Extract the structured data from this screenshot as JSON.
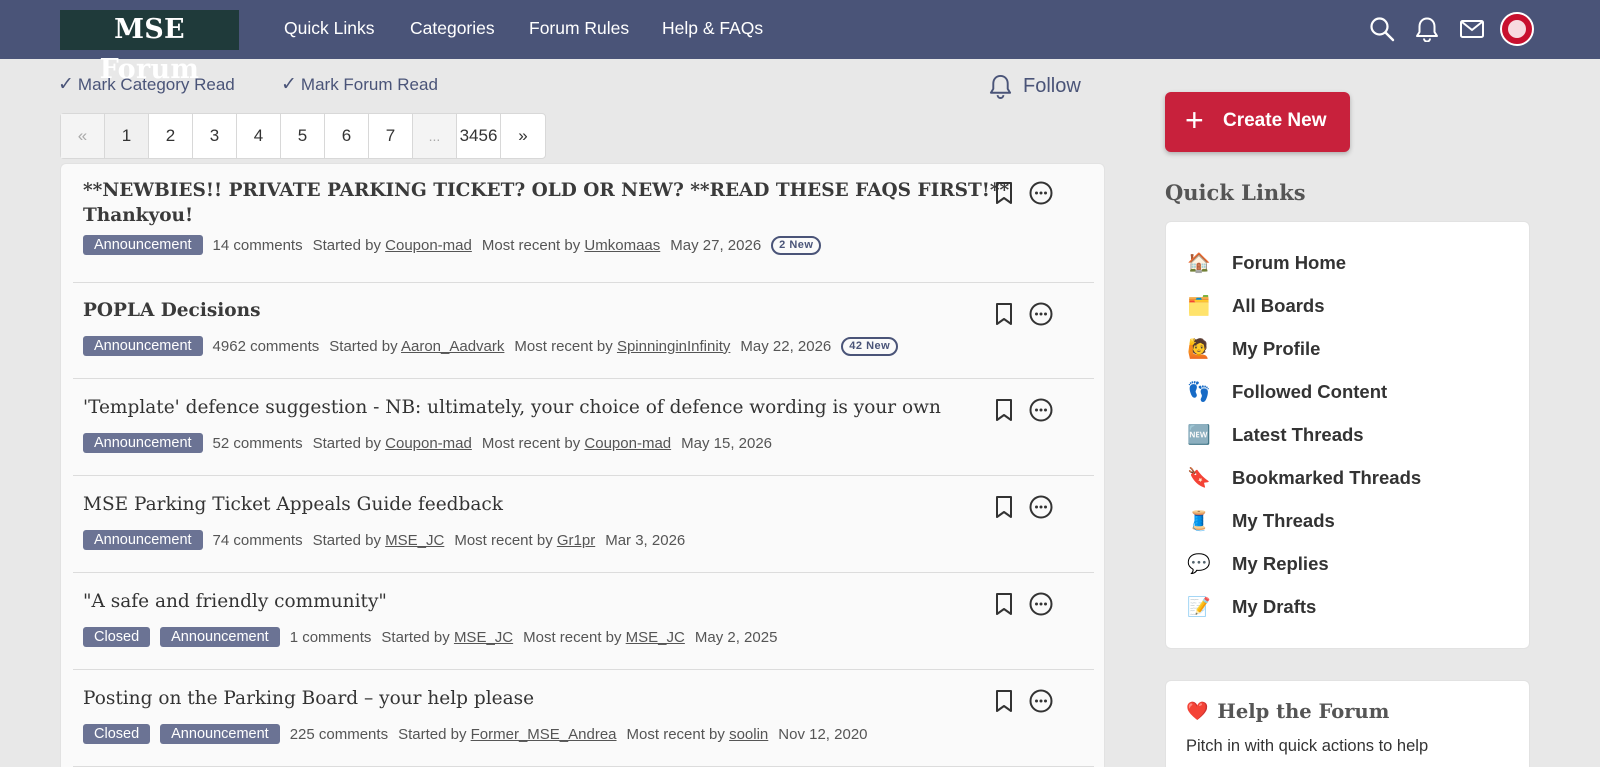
{
  "header": {
    "logo": "MSE Forum",
    "nav": [
      "Quick Links",
      "Categories",
      "Forum Rules",
      "Help & FAQs"
    ],
    "icons": [
      "search-icon",
      "bell-icon",
      "mail-icon",
      "avatar"
    ]
  },
  "actions": {
    "mark_category": "Mark Category Read",
    "mark_forum": "Mark Forum Read",
    "check": "✓",
    "follow": "Follow"
  },
  "pagination": {
    "prev": "«",
    "pages": [
      "1",
      "2",
      "3",
      "4",
      "5",
      "6",
      "7"
    ],
    "ellipsis": "...",
    "last": "3456",
    "next": "»",
    "current": "1"
  },
  "threads": [
    {
      "title_line1": "**NEWBIES!! PRIVATE PARKING TICKET? OLD OR NEW? **READ THESE FAQS FIRST!**",
      "title_line2": "Thankyou!",
      "tags": [
        "Announcement"
      ],
      "comments": "14 comments",
      "started_label": "Started by",
      "started_by": "Coupon-mad",
      "recent_label": "Most recent by",
      "recent_by": "Umkomaas",
      "date": "May 27, 2026",
      "new": "2 New"
    },
    {
      "title_line1": "POPLA Decisions",
      "tags": [
        "Announcement"
      ],
      "comments": "4962 comments",
      "started_label": "Started by",
      "started_by": "Aaron_Aadvark",
      "recent_label": "Most recent by",
      "recent_by": "SpinninginInfinity",
      "date": "May 22, 2026",
      "new": "42 New"
    },
    {
      "title_line1": "'Template' defence suggestion - NB: ultimately, your choice of defence wording is your own",
      "tags": [
        "Announcement"
      ],
      "comments": "52 comments",
      "started_label": "Started by",
      "started_by": "Coupon-mad",
      "recent_label": "Most recent by",
      "recent_by": "Coupon-mad",
      "date": "May 15, 2026"
    },
    {
      "title_line1": "MSE Parking Ticket Appeals Guide feedback",
      "tags": [
        "Announcement"
      ],
      "comments": "74 comments",
      "started_label": "Started by",
      "started_by": "MSE_JC",
      "recent_label": "Most recent by",
      "recent_by": "Gr1pr",
      "date": "Mar 3, 2026"
    },
    {
      "title_line1": "\"A safe and friendly community\"",
      "tags": [
        "Closed",
        "Announcement"
      ],
      "comments": "1 comments",
      "started_label": "Started by",
      "started_by": "MSE_JC",
      "recent_label": "Most recent by",
      "recent_by": "MSE_JC",
      "date": "May 2, 2025"
    },
    {
      "title_line1": "Posting on the Parking Board – your help please",
      "tags": [
        "Closed",
        "Announcement"
      ],
      "comments": "225 comments",
      "started_label": "Started by",
      "started_by": "Former_MSE_Andrea",
      "recent_label": "Most recent by",
      "recent_by": "soolin",
      "date": "Nov 12, 2020"
    }
  ],
  "sidebar": {
    "create": "Create New",
    "plus": "+",
    "quick_links_title": "Quick Links",
    "quick_links": [
      {
        "emoji": "🏠",
        "label": "Forum Home",
        "icon": "house-icon"
      },
      {
        "emoji": "🗂️",
        "label": "All Boards",
        "icon": "card-index-dividers-icon"
      },
      {
        "emoji": "🙋",
        "label": "My Profile",
        "icon": "person-raising-hand-icon"
      },
      {
        "emoji": "👣",
        "label": "Followed Content",
        "icon": "footprints-icon"
      },
      {
        "emoji": "🆕",
        "label": "Latest Threads",
        "icon": "new-button-icon"
      },
      {
        "emoji": "🔖",
        "label": "Bookmarked Threads",
        "icon": "bookmark-tag-icon"
      },
      {
        "emoji": "🧵",
        "label": "My Threads",
        "icon": "thread-spool-icon"
      },
      {
        "emoji": "💬",
        "label": "My Replies",
        "icon": "speech-balloon-icon"
      },
      {
        "emoji": "📝",
        "label": "My Drafts",
        "icon": "memo-icon"
      }
    ],
    "help_emoji": "❤️",
    "help_title": "Help the Forum",
    "help_text": "Pitch in with quick actions to help"
  },
  "colors": {
    "header": "#4a5478",
    "accent_red": "#c8213c",
    "badge": "#6b7394",
    "logo_bg": "#1f3a3a"
  }
}
